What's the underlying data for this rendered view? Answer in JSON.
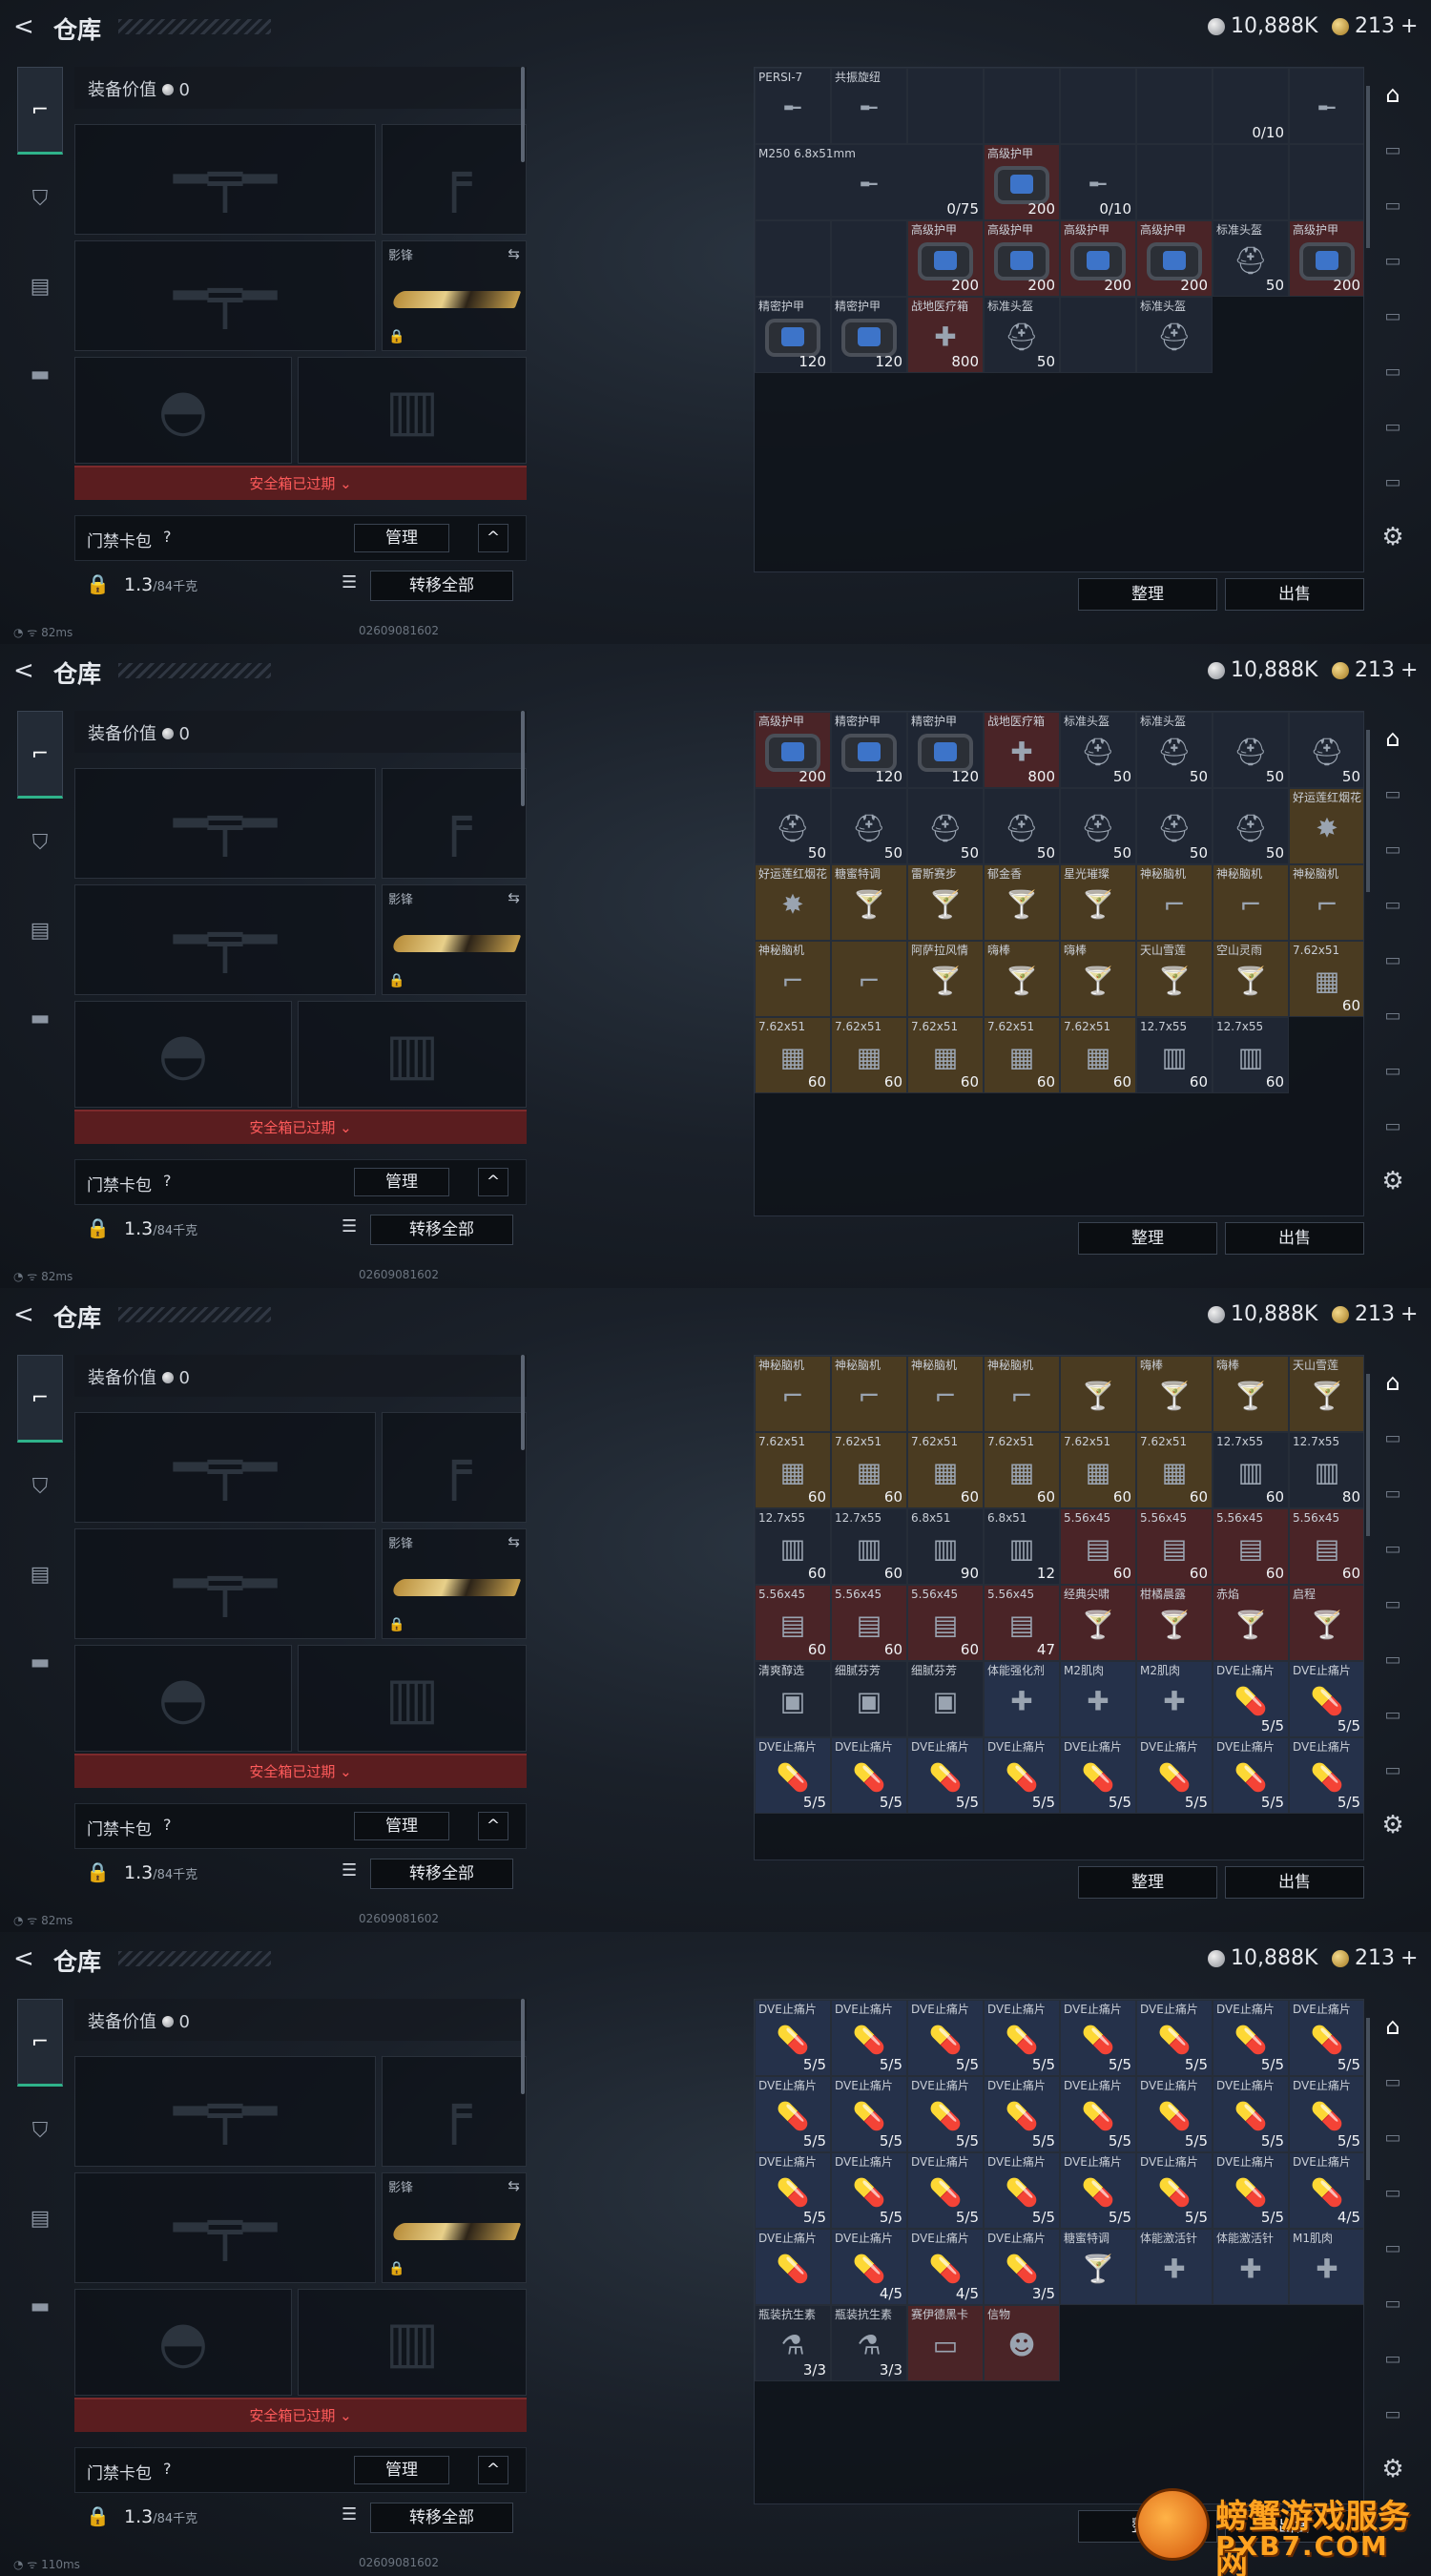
{
  "header": {
    "back_label": "<",
    "title": "仓库",
    "silver": "10,888K",
    "gold": "213",
    "gold_plus": "+"
  },
  "loadout": {
    "value_label": "装备价值",
    "value": "0",
    "knife_label": "影锋",
    "safe_box_text": "安全箱已过期 ⌄",
    "card_pack_label": "门禁卡包",
    "card_pack_help": "?",
    "manage_button": "管理",
    "collapse_button": "^",
    "weight": "1.3",
    "weight_unit": "/84千克",
    "transfer_button": "转移全部"
  },
  "stash": {
    "sort_button": "整理",
    "sell_button": "出售"
  },
  "footer_ping": [
    "82ms",
    "82ms",
    "82ms",
    "110ms"
  ],
  "footer_id": "02609081602",
  "watermark": {
    "title": "螃蟹游戏服务网",
    "url": "PXB7.COM"
  },
  "screens": [
    {
      "items": [
        {
          "n": "PERSI-7",
          "v": "",
          "t": "gun"
        },
        {
          "n": "共振旋纽",
          "v": "",
          "t": "gun"
        },
        {
          "n": "",
          "v": "",
          "t": "e"
        },
        {
          "n": "",
          "v": "",
          "t": "e"
        },
        {
          "n": "",
          "v": "",
          "t": "e"
        },
        {
          "n": "",
          "v": "",
          "t": "e"
        },
        {
          "n": "",
          "v": "0/10",
          "t": "e"
        },
        {
          "n": "",
          "v": "",
          "t": "gun"
        },
        {
          "n": "M250 6.8x51mm",
          "v": "0/75",
          "t": "gun",
          "span": 3
        },
        {
          "n": "高级护甲",
          "v": "200",
          "t": "armor",
          "c": "red"
        },
        {
          "n": "",
          "v": "0/10",
          "t": "gun"
        },
        {
          "n": "",
          "v": "",
          "t": "e"
        },
        {
          "n": "",
          "v": "",
          "t": "e"
        },
        {
          "n": "",
          "v": "",
          "t": "e"
        },
        {
          "n": "",
          "v": "",
          "t": "e"
        },
        {
          "n": "",
          "v": "",
          "t": "e"
        },
        {
          "n": "高级护甲",
          "v": "200",
          "t": "armor",
          "c": "red"
        },
        {
          "n": "高级护甲",
          "v": "200",
          "t": "armor",
          "c": "red"
        },
        {
          "n": "高级护甲",
          "v": "200",
          "t": "armor",
          "c": "red"
        },
        {
          "n": "高级护甲",
          "v": "200",
          "t": "armor",
          "c": "red"
        },
        {
          "n": "标准头盔",
          "v": "50",
          "t": "helm"
        },
        {
          "n": "高级护甲",
          "v": "200",
          "t": "armor",
          "c": "red"
        },
        {
          "n": "精密护甲",
          "v": "120",
          "t": "armor"
        },
        {
          "n": "精密护甲",
          "v": "120",
          "t": "armor"
        },
        {
          "n": "战地医疗箱",
          "v": "800",
          "t": "med",
          "c": "red"
        },
        {
          "n": "标准头盔",
          "v": "50",
          "t": "helm"
        },
        {
          "n": "",
          "v": "",
          "t": "e"
        },
        {
          "n": "标准头盔",
          "v": "",
          "t": "helm"
        }
      ]
    },
    {
      "items": [
        {
          "n": "高级护甲",
          "v": "200",
          "t": "armor",
          "c": "red"
        },
        {
          "n": "精密护甲",
          "v": "120",
          "t": "armor"
        },
        {
          "n": "精密护甲",
          "v": "120",
          "t": "armor"
        },
        {
          "n": "战地医疗箱",
          "v": "800",
          "t": "med",
          "c": "red"
        },
        {
          "n": "标准头盔",
          "v": "50",
          "t": "helm"
        },
        {
          "n": "标准头盔",
          "v": "50",
          "t": "helm"
        },
        {
          "n": "",
          "v": "50",
          "t": "helm"
        },
        {
          "n": "",
          "v": "50",
          "t": "helm"
        },
        {
          "n": "",
          "v": "50",
          "t": "helm"
        },
        {
          "n": "",
          "v": "50",
          "t": "helm"
        },
        {
          "n": "",
          "v": "50",
          "t": "helm"
        },
        {
          "n": "",
          "v": "50",
          "t": "helm"
        },
        {
          "n": "",
          "v": "50",
          "t": "helm"
        },
        {
          "n": "",
          "v": "50",
          "t": "helm"
        },
        {
          "n": "",
          "v": "50",
          "t": "helm"
        },
        {
          "n": "好运莲红烟花",
          "v": "",
          "t": "fw",
          "c": "gold"
        },
        {
          "n": "好运莲红烟花",
          "v": "",
          "t": "fw",
          "c": "gold"
        },
        {
          "n": "糖蜜特调",
          "v": "",
          "t": "drink",
          "c": "gold"
        },
        {
          "n": "雷斯赛步",
          "v": "",
          "t": "drink",
          "c": "gold"
        },
        {
          "n": "郁金香",
          "v": "",
          "t": "drink",
          "c": "gold"
        },
        {
          "n": "星光璀璨",
          "v": "",
          "t": "drink",
          "c": "gold"
        },
        {
          "n": "神秘脑机",
          "v": "",
          "t": "pipe",
          "c": "gold"
        },
        {
          "n": "神秘脑机",
          "v": "",
          "t": "pipe",
          "c": "gold"
        },
        {
          "n": "神秘脑机",
          "v": "",
          "t": "pipe",
          "c": "gold"
        },
        {
          "n": "神秘脑机",
          "v": "",
          "t": "pipe",
          "c": "gold"
        },
        {
          "n": "",
          "v": "",
          "t": "pipe",
          "c": "gold"
        },
        {
          "n": "阿萨拉风情",
          "v": "",
          "t": "drink",
          "c": "gold"
        },
        {
          "n": "嗨棒",
          "v": "",
          "t": "drink",
          "c": "gold"
        },
        {
          "n": "嗨棒",
          "v": "",
          "t": "drink",
          "c": "gold"
        },
        {
          "n": "天山雪莲",
          "v": "",
          "t": "drink",
          "c": "gold"
        },
        {
          "n": "空山灵雨",
          "v": "",
          "t": "drink",
          "c": "gold"
        },
        {
          "n": "7.62x51",
          "v": "60",
          "t": "ammo",
          "c": "gold"
        },
        {
          "n": "7.62x51",
          "v": "60",
          "t": "ammo",
          "c": "gold"
        },
        {
          "n": "7.62x51",
          "v": "60",
          "t": "ammo",
          "c": "gold"
        },
        {
          "n": "7.62x51",
          "v": "60",
          "t": "ammo",
          "c": "gold"
        },
        {
          "n": "7.62x51",
          "v": "60",
          "t": "ammo",
          "c": "gold"
        },
        {
          "n": "7.62x51",
          "v": "60",
          "t": "ammo",
          "c": "gold"
        },
        {
          "n": "12.7x55",
          "v": "60",
          "t": "ammo2"
        },
        {
          "n": "12.7x55",
          "v": "60",
          "t": "ammo2"
        }
      ]
    },
    {
      "items": [
        {
          "n": "神秘脑机",
          "v": "",
          "t": "pipe",
          "c": "gold"
        },
        {
          "n": "神秘脑机",
          "v": "",
          "t": "pipe",
          "c": "gold"
        },
        {
          "n": "神秘脑机",
          "v": "",
          "t": "pipe",
          "c": "gold"
        },
        {
          "n": "神秘脑机",
          "v": "",
          "t": "pipe",
          "c": "gold"
        },
        {
          "n": "",
          "v": "",
          "t": "drink",
          "c": "gold"
        },
        {
          "n": "嗨棒",
          "v": "",
          "t": "drink",
          "c": "gold"
        },
        {
          "n": "嗨棒",
          "v": "",
          "t": "drink",
          "c": "gold"
        },
        {
          "n": "天山雪莲",
          "v": "",
          "t": "drink",
          "c": "gold"
        },
        {
          "n": "7.62x51",
          "v": "60",
          "t": "ammo",
          "c": "gold"
        },
        {
          "n": "7.62x51",
          "v": "60",
          "t": "ammo",
          "c": "gold"
        },
        {
          "n": "7.62x51",
          "v": "60",
          "t": "ammo",
          "c": "gold"
        },
        {
          "n": "7.62x51",
          "v": "60",
          "t": "ammo",
          "c": "gold"
        },
        {
          "n": "7.62x51",
          "v": "60",
          "t": "ammo",
          "c": "gold"
        },
        {
          "n": "7.62x51",
          "v": "60",
          "t": "ammo",
          "c": "gold"
        },
        {
          "n": "12.7x55",
          "v": "60",
          "t": "ammo2"
        },
        {
          "n": "12.7x55",
          "v": "80",
          "t": "ammo2"
        },
        {
          "n": "12.7x55",
          "v": "60",
          "t": "ammo2"
        },
        {
          "n": "12.7x55",
          "v": "60",
          "t": "ammo2"
        },
        {
          "n": "6.8x51",
          "v": "90",
          "t": "ammo2"
        },
        {
          "n": "6.8x51",
          "v": "12",
          "t": "ammo2"
        },
        {
          "n": "5.56x45",
          "v": "60",
          "t": "ammo3",
          "c": "red"
        },
        {
          "n": "5.56x45",
          "v": "60",
          "t": "ammo3",
          "c": "red"
        },
        {
          "n": "5.56x45",
          "v": "60",
          "t": "ammo3",
          "c": "red"
        },
        {
          "n": "5.56x45",
          "v": "60",
          "t": "ammo3",
          "c": "red"
        },
        {
          "n": "5.56x45",
          "v": "60",
          "t": "ammo3",
          "c": "red"
        },
        {
          "n": "5.56x45",
          "v": "60",
          "t": "ammo3",
          "c": "red"
        },
        {
          "n": "5.56x45",
          "v": "60",
          "t": "ammo3",
          "c": "red"
        },
        {
          "n": "5.56x45",
          "v": "47",
          "t": "ammo3",
          "c": "red"
        },
        {
          "n": "经典尖啸",
          "v": "",
          "t": "drink",
          "c": "red"
        },
        {
          "n": "柑橘晨露",
          "v": "",
          "t": "drink",
          "c": "red"
        },
        {
          "n": "赤焰",
          "v": "",
          "t": "drink",
          "c": "red"
        },
        {
          "n": "启程",
          "v": "",
          "t": "drink",
          "c": "red"
        },
        {
          "n": "清爽醇选",
          "v": "",
          "t": "can"
        },
        {
          "n": "细腻芬芳",
          "v": "",
          "t": "can"
        },
        {
          "n": "细腻芬芳",
          "v": "",
          "t": "can"
        },
        {
          "n": "体能强化剂",
          "v": "",
          "t": "inj",
          "c": "blue"
        },
        {
          "n": "M2肌肉",
          "v": "",
          "t": "inj",
          "c": "blue"
        },
        {
          "n": "M2肌肉",
          "v": "",
          "t": "inj",
          "c": "blue"
        },
        {
          "n": "DVE止痛片",
          "v": "5/5",
          "t": "pill",
          "c": "blue"
        },
        {
          "n": "DVE止痛片",
          "v": "5/5",
          "t": "pill",
          "c": "blue"
        },
        {
          "n": "DVE止痛片",
          "v": "5/5",
          "t": "pill",
          "c": "blue"
        },
        {
          "n": "DVE止痛片",
          "v": "5/5",
          "t": "pill",
          "c": "blue"
        },
        {
          "n": "DVE止痛片",
          "v": "5/5",
          "t": "pill",
          "c": "blue"
        },
        {
          "n": "DVE止痛片",
          "v": "5/5",
          "t": "pill",
          "c": "blue"
        },
        {
          "n": "DVE止痛片",
          "v": "5/5",
          "t": "pill",
          "c": "blue"
        },
        {
          "n": "DVE止痛片",
          "v": "5/5",
          "t": "pill",
          "c": "blue"
        },
        {
          "n": "DVE止痛片",
          "v": "5/5",
          "t": "pill",
          "c": "blue"
        },
        {
          "n": "DVE止痛片",
          "v": "5/5",
          "t": "pill",
          "c": "blue"
        }
      ]
    },
    {
      "items": [
        {
          "n": "DVE止痛片",
          "v": "5/5",
          "t": "pill",
          "c": "blue"
        },
        {
          "n": "DVE止痛片",
          "v": "5/5",
          "t": "pill",
          "c": "blue"
        },
        {
          "n": "DVE止痛片",
          "v": "5/5",
          "t": "pill",
          "c": "blue"
        },
        {
          "n": "DVE止痛片",
          "v": "5/5",
          "t": "pill",
          "c": "blue"
        },
        {
          "n": "DVE止痛片",
          "v": "5/5",
          "t": "pill",
          "c": "blue"
        },
        {
          "n": "DVE止痛片",
          "v": "5/5",
          "t": "pill",
          "c": "blue"
        },
        {
          "n": "DVE止痛片",
          "v": "5/5",
          "t": "pill",
          "c": "blue"
        },
        {
          "n": "DVE止痛片",
          "v": "5/5",
          "t": "pill",
          "c": "blue"
        },
        {
          "n": "DVE止痛片",
          "v": "5/5",
          "t": "pill",
          "c": "blue"
        },
        {
          "n": "DVE止痛片",
          "v": "5/5",
          "t": "pill",
          "c": "blue"
        },
        {
          "n": "DVE止痛片",
          "v": "5/5",
          "t": "pill",
          "c": "blue"
        },
        {
          "n": "DVE止痛片",
          "v": "5/5",
          "t": "pill",
          "c": "blue"
        },
        {
          "n": "DVE止痛片",
          "v": "5/5",
          "t": "pill",
          "c": "blue"
        },
        {
          "n": "DVE止痛片",
          "v": "5/5",
          "t": "pill",
          "c": "blue"
        },
        {
          "n": "DVE止痛片",
          "v": "5/5",
          "t": "pill",
          "c": "blue"
        },
        {
          "n": "DVE止痛片",
          "v": "5/5",
          "t": "pill",
          "c": "blue"
        },
        {
          "n": "DVE止痛片",
          "v": "5/5",
          "t": "pill",
          "c": "blue"
        },
        {
          "n": "DVE止痛片",
          "v": "5/5",
          "t": "pill",
          "c": "blue"
        },
        {
          "n": "DVE止痛片",
          "v": "5/5",
          "t": "pill",
          "c": "blue"
        },
        {
          "n": "DVE止痛片",
          "v": "5/5",
          "t": "pill",
          "c": "blue"
        },
        {
          "n": "DVE止痛片",
          "v": "5/5",
          "t": "pill",
          "c": "blue"
        },
        {
          "n": "DVE止痛片",
          "v": "5/5",
          "t": "pill",
          "c": "blue"
        },
        {
          "n": "DVE止痛片",
          "v": "5/5",
          "t": "pill",
          "c": "blue"
        },
        {
          "n": "DVE止痛片",
          "v": "4/5",
          "t": "pill",
          "c": "blue"
        },
        {
          "n": "DVE止痛片",
          "v": "",
          "t": "pill",
          "c": "blue"
        },
        {
          "n": "DVE止痛片",
          "v": "4/5",
          "t": "pill",
          "c": "blue"
        },
        {
          "n": "DVE止痛片",
          "v": "4/5",
          "t": "pill",
          "c": "blue"
        },
        {
          "n": "DVE止痛片",
          "v": "3/5",
          "t": "pill",
          "c": "blue"
        },
        {
          "n": "糖蜜特调",
          "v": "",
          "t": "drink",
          "c": "blue"
        },
        {
          "n": "体能激活针",
          "v": "",
          "t": "inj",
          "c": "blue"
        },
        {
          "n": "体能激活针",
          "v": "",
          "t": "inj",
          "c": "blue"
        },
        {
          "n": "M1肌肉",
          "v": "",
          "t": "inj",
          "c": "blue"
        },
        {
          "n": "瓶装抗生素",
          "v": "3/3",
          "t": "bottle"
        },
        {
          "n": "瓶装抗生素",
          "v": "3/3",
          "t": "bottle"
        },
        {
          "n": "赛伊德黑卡",
          "v": "",
          "t": "card",
          "c": "red"
        },
        {
          "n": "信物",
          "v": "",
          "t": "mask",
          "c": "red"
        }
      ]
    }
  ]
}
